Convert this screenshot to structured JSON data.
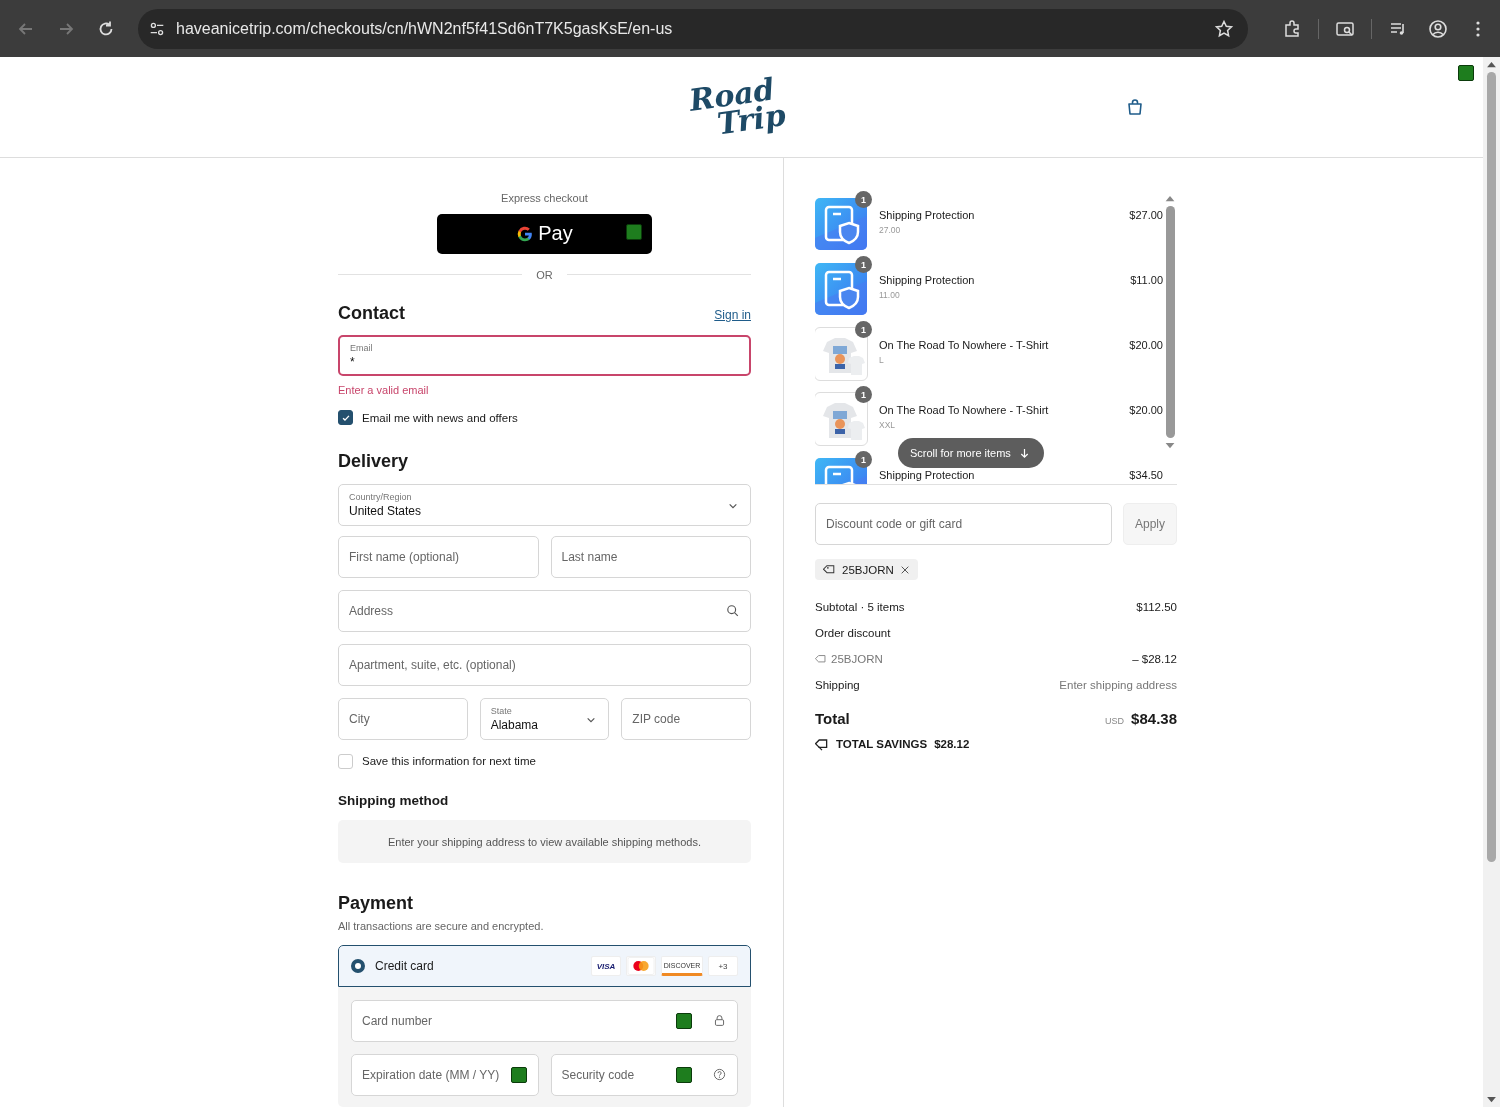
{
  "browser": {
    "url": "haveanicetrip.com/checkouts/cn/hWN2nf5f41Sd6nT7K5gasKsE/en-us"
  },
  "header": {
    "logo": [
      "Road",
      "Trip"
    ]
  },
  "express": {
    "label": "Express checkout",
    "gpay": "Pay",
    "divider": "OR"
  },
  "contact": {
    "title": "Contact",
    "sign_in": "Sign in",
    "email": {
      "label": "Email",
      "value": "*",
      "error": "Enter a valid email"
    },
    "newsletter": {
      "label": "Email me with news and offers",
      "checked": true
    }
  },
  "delivery": {
    "title": "Delivery",
    "country": {
      "label": "Country/Region",
      "value": "United States"
    },
    "first_name": {
      "placeholder": "First name (optional)"
    },
    "last_name": {
      "placeholder": "Last name"
    },
    "address": {
      "placeholder": "Address"
    },
    "apartment": {
      "placeholder": "Apartment, suite, etc. (optional)"
    },
    "city": {
      "placeholder": "City"
    },
    "state": {
      "label": "State",
      "value": "Alabama"
    },
    "zip": {
      "placeholder": "ZIP code"
    },
    "save_info": {
      "label": "Save this information for next time",
      "checked": false
    }
  },
  "shipping_method": {
    "title": "Shipping method",
    "message": "Enter your shipping address to view available shipping methods."
  },
  "payment": {
    "title": "Payment",
    "subtitle": "All transactions are secure and encrypted.",
    "methods": [
      {
        "label": "Credit card",
        "selected": true
      }
    ],
    "card_brands": [
      {
        "kind": "visa",
        "text": "VISA"
      },
      {
        "kind": "mastercard"
      },
      {
        "kind": "discover",
        "text": "DISCOVER"
      },
      {
        "kind": "more",
        "text": "+3"
      }
    ],
    "card_number": {
      "placeholder": "Card number"
    },
    "expiry": {
      "placeholder": "Expiration date (MM / YY)"
    },
    "security_code": {
      "placeholder": "Security code"
    }
  },
  "summary": {
    "items": [
      {
        "kind": "protection",
        "quantity": "1",
        "name": "Shipping Protection",
        "detail": "27.00",
        "price": "$27.00"
      },
      {
        "kind": "protection",
        "quantity": "1",
        "name": "Shipping Protection",
        "detail": "11.00",
        "price": "$11.00"
      },
      {
        "kind": "shirt",
        "quantity": "1",
        "name": "On The Road To Nowhere - T-Shirt",
        "detail": "L",
        "price": "$20.00"
      },
      {
        "kind": "shirt",
        "quantity": "1",
        "name": "On The Road To Nowhere - T-Shirt",
        "detail": "XXL",
        "price": "$20.00"
      },
      {
        "kind": "protection",
        "quantity": "1",
        "name": "Shipping Protection",
        "price": "$34.50"
      }
    ],
    "scroll_hint": "Scroll for more items",
    "discount": {
      "placeholder": "Discount code or gift card",
      "button": "Apply"
    },
    "applied_code": "25BJORN",
    "subtotal": {
      "label": "Subtotal · 5 items",
      "value": "$112.50"
    },
    "order_discount": {
      "label": "Order discount",
      "code": "25BJORN",
      "value": "– $28.12"
    },
    "shipping": {
      "label": "Shipping",
      "value": "Enter shipping address"
    },
    "total": {
      "label": "Total",
      "currency": "USD",
      "value": "$84.38"
    },
    "savings": {
      "label": "TOTAL SAVINGS",
      "value": "$28.12"
    }
  }
}
